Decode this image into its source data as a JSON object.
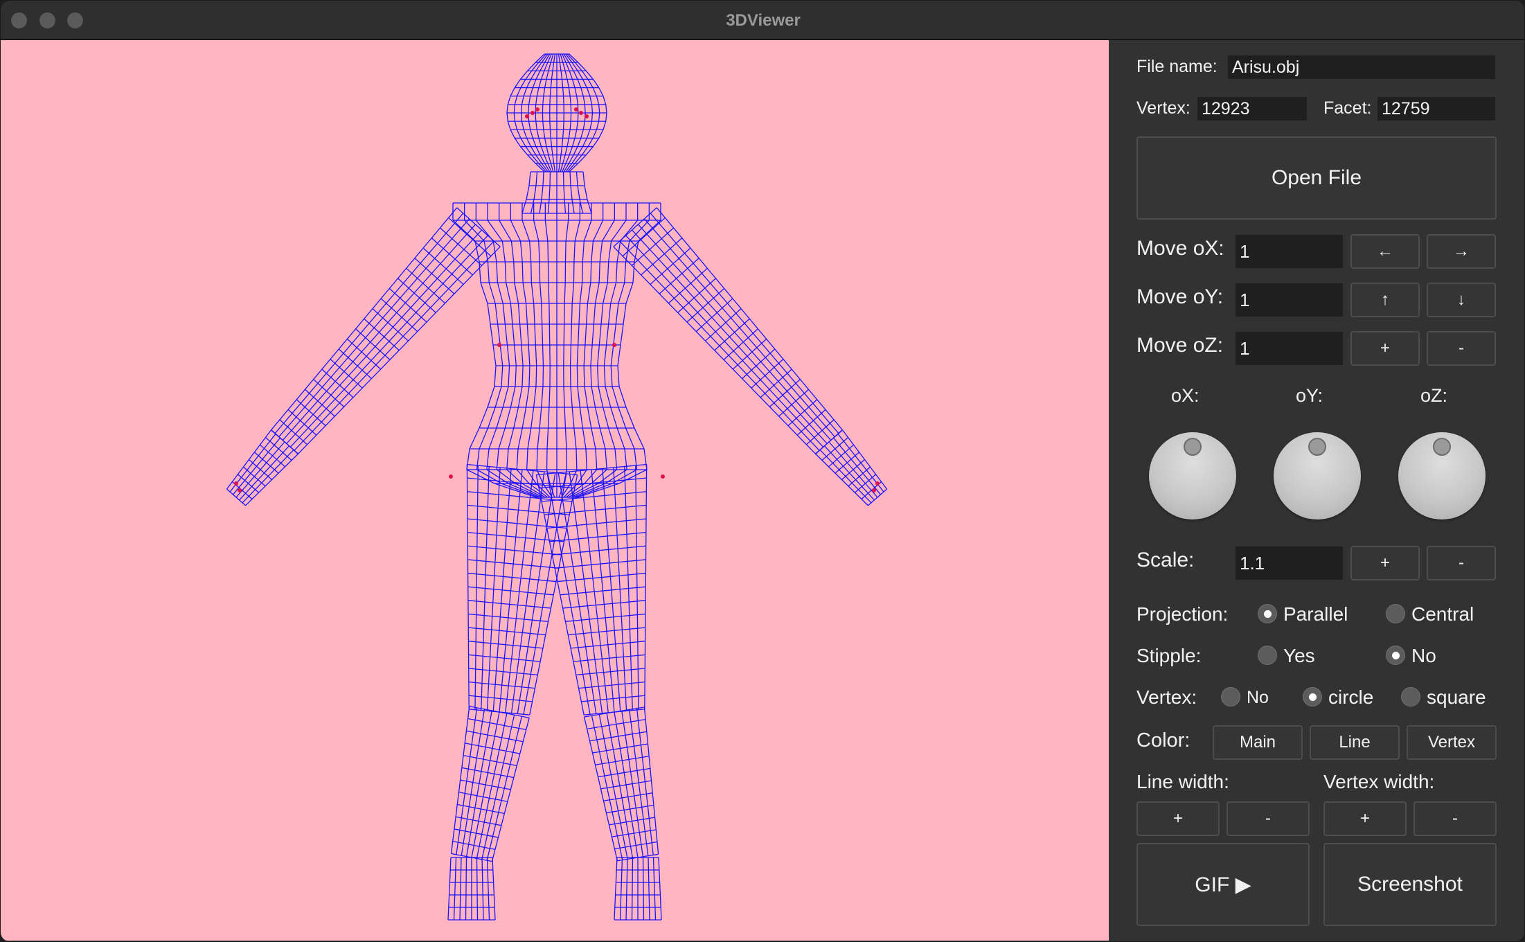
{
  "window": {
    "title": "3DViewer"
  },
  "viewport": {
    "background": "#ffb6c1",
    "line_color": "#1a12ff",
    "vertex_color": "#e0104a"
  },
  "panel": {
    "file_name_label": "File name:",
    "file_name_value": "Arisu.obj",
    "vertex_label": "Vertex:",
    "vertex_value": "12923",
    "facet_label": "Facet:",
    "facet_value": "12759",
    "open_file_label": "Open File",
    "move_ox_label": "Move oX:",
    "move_ox_value": "1",
    "move_ox_left": "←",
    "move_ox_right": "→",
    "move_oy_label": "Move oY:",
    "move_oy_value": "1",
    "move_oy_up": "↑",
    "move_oy_down": "↓",
    "move_oz_label": "Move oZ:",
    "move_oz_value": "1",
    "move_oz_plus": "+",
    "move_oz_minus": "-",
    "rot_ox_label": "oX:",
    "rot_oy_label": "oY:",
    "rot_oz_label": "oZ:",
    "scale_label": "Scale:",
    "scale_value": "1.1",
    "scale_plus": "+",
    "scale_minus": "-",
    "projection_label": "Projection:",
    "projection_parallel": "Parallel",
    "projection_central": "Central",
    "projection_selected": "Parallel",
    "stipple_label": "Stipple:",
    "stipple_yes": "Yes",
    "stipple_no": "No",
    "stipple_selected": "No",
    "vertex_mode_label": "Vertex:",
    "vertex_mode_no": "No",
    "vertex_mode_circle": "circle",
    "vertex_mode_square": "square",
    "vertex_mode_selected": "circle",
    "color_label": "Color:",
    "color_main": "Main",
    "color_line": "Line",
    "color_vertex": "Vertex",
    "line_width_label": "Line width:",
    "line_width_plus": "+",
    "line_width_minus": "-",
    "vertex_width_label": "Vertex width:",
    "vertex_width_plus": "+",
    "vertex_width_minus": "-",
    "gif_label": "GIF ▶",
    "screenshot_label": "Screenshot"
  }
}
